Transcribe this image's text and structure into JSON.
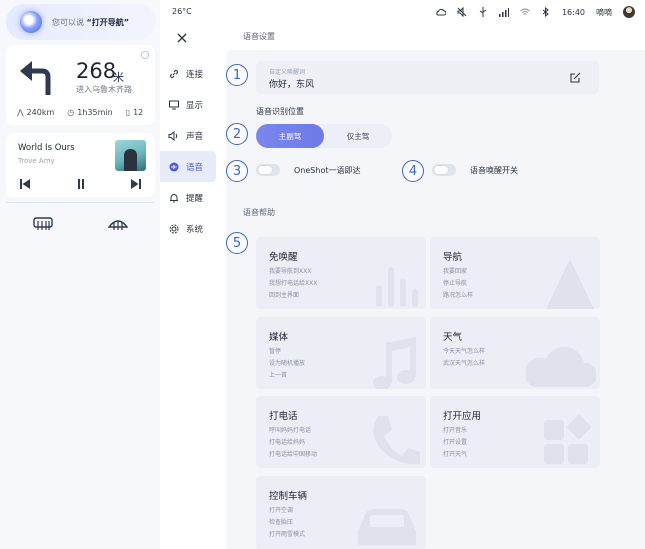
{
  "assistant": {
    "hint_prefix": "您可以说",
    "hint_command": "“打开导航”"
  },
  "navigation": {
    "distance": "268",
    "distance_unit": "米",
    "road": "进入乌鲁木齐路",
    "remaining_distance": "240km",
    "remaining_time": "1h35min",
    "lights": "12"
  },
  "media": {
    "song": "World Is Ours",
    "artist": "Trove Amy"
  },
  "status_bar": {
    "temperature": "26°C",
    "time": "16:40",
    "user": "嘀嘀"
  },
  "menu": [
    {
      "label": "连接",
      "icon": "link-icon"
    },
    {
      "label": "显示",
      "icon": "monitor-icon"
    },
    {
      "label": "声音",
      "icon": "speaker-icon"
    },
    {
      "label": "语音",
      "icon": "voice-icon"
    },
    {
      "label": "提醒",
      "icon": "bell-icon"
    },
    {
      "label": "系统",
      "icon": "gear-icon"
    }
  ],
  "voice_settings": {
    "section_title": "语音设置",
    "wake_word_caption": "自定义唤醒词",
    "wake_word": "你好，东风",
    "position_title": "语音识别位置",
    "position_options": [
      "主副驾",
      "仅主驾"
    ],
    "selected_position": "主副驾",
    "oneshot_label": "OneShot一语即达",
    "wake_switch_label": "语音唤醒开关"
  },
  "voice_help": {
    "section_title": "语音帮助",
    "cards": [
      {
        "title": "免唤醒",
        "lines": [
          "我要导航到XXX",
          "我想打电话给XXX",
          "回到主界面"
        ]
      },
      {
        "title": "导航",
        "lines": [
          "我要回家",
          "停止导航",
          "路况怎么样"
        ]
      },
      {
        "title": "媒体",
        "lines": [
          "暂停",
          "设为随机播放",
          "上一首"
        ]
      },
      {
        "title": "天气",
        "lines": [
          "今天天气怎么样",
          "武汉天气怎么样"
        ]
      },
      {
        "title": "打电话",
        "lines": [
          "呼叫妈妈打电话",
          "打电话给妈妈",
          "打电话给中国移动"
        ]
      },
      {
        "title": "打开应用",
        "lines": [
          "打开音乐",
          "打开设置",
          "打开天气"
        ]
      },
      {
        "title": "控制车辆",
        "lines": [
          "打开空调",
          "检查胎压",
          "打开雨雪模式"
        ]
      }
    ]
  },
  "markers": [
    "1",
    "2",
    "3",
    "4",
    "5"
  ],
  "colors": {
    "accent": "#6d79e8",
    "marker": "#3a68b8"
  }
}
